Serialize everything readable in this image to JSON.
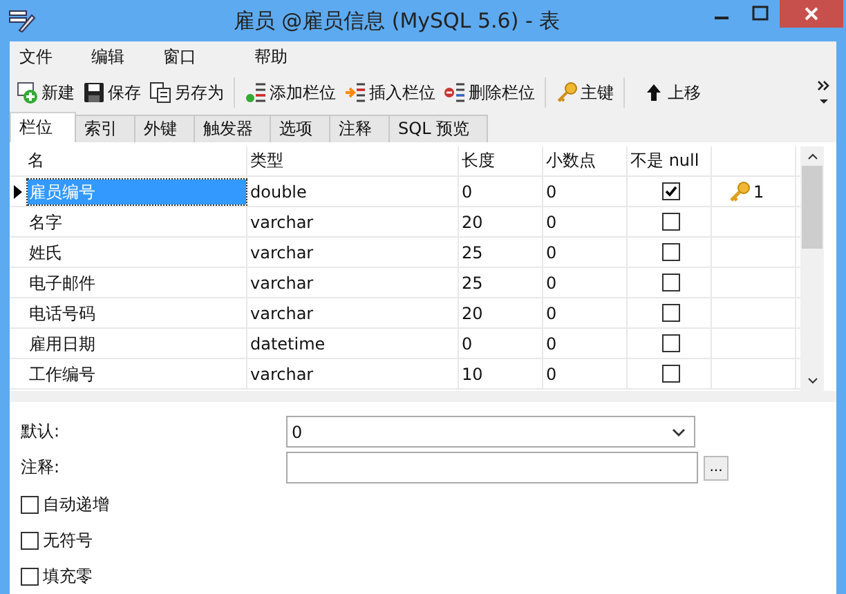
{
  "window": {
    "title": "雇员 @雇员信息 (MySQL 5.6) - 表"
  },
  "menu": [
    "文件",
    "编辑",
    "窗口",
    "帮助"
  ],
  "toolbar": [
    {
      "kind": "new",
      "label": "新建"
    },
    {
      "kind": "save",
      "label": "保存"
    },
    {
      "kind": "save-as",
      "label": "另存为"
    },
    {
      "kind": "add-column",
      "label": "添加栏位"
    },
    {
      "kind": "insert-column",
      "label": "插入栏位"
    },
    {
      "kind": "delete-column",
      "label": "删除栏位"
    },
    {
      "kind": "key",
      "label": "主键"
    },
    {
      "kind": "up",
      "label": "上移"
    }
  ],
  "tabs": [
    {
      "label": "栏位",
      "selected": true
    },
    {
      "label": "索引",
      "selected": false
    },
    {
      "label": "外键",
      "selected": false
    },
    {
      "label": "触发器",
      "selected": false
    },
    {
      "label": "选项",
      "selected": false
    },
    {
      "label": "注释",
      "selected": false
    },
    {
      "label": "SQL 预览",
      "selected": false
    }
  ],
  "table": {
    "columns": [
      "名",
      "类型",
      "长度",
      "小数点",
      "不是 null"
    ],
    "rows": [
      {
        "name": "雇员编号",
        "type": "double",
        "length": "0",
        "decimals": "0",
        "not_null": true,
        "primary_key": true,
        "key_order": "1",
        "selected": true
      },
      {
        "name": "名字",
        "type": "varchar",
        "length": "20",
        "decimals": "0",
        "not_null": false,
        "primary_key": false,
        "selected": false
      },
      {
        "name": "姓氏",
        "type": "varchar",
        "length": "25",
        "decimals": "0",
        "not_null": false,
        "primary_key": false,
        "selected": false
      },
      {
        "name": "电子邮件",
        "type": "varchar",
        "length": "25",
        "decimals": "0",
        "not_null": false,
        "primary_key": false,
        "selected": false
      },
      {
        "name": "电话号码",
        "type": "varchar",
        "length": "20",
        "decimals": "0",
        "not_null": false,
        "primary_key": false,
        "selected": false
      },
      {
        "name": "雇用日期",
        "type": "datetime",
        "length": "0",
        "decimals": "0",
        "not_null": false,
        "primary_key": false,
        "selected": false
      },
      {
        "name": "工作编号",
        "type": "varchar",
        "length": "10",
        "decimals": "0",
        "not_null": false,
        "primary_key": false,
        "selected": false
      }
    ]
  },
  "properties": {
    "default_label": "默认:",
    "default_value": "0",
    "comment_label": "注释:",
    "comment_button": "...",
    "options": [
      {
        "label": "自动递增",
        "checked": false
      },
      {
        "label": "无符号",
        "checked": false
      },
      {
        "label": "填充零",
        "checked": false
      }
    ]
  }
}
